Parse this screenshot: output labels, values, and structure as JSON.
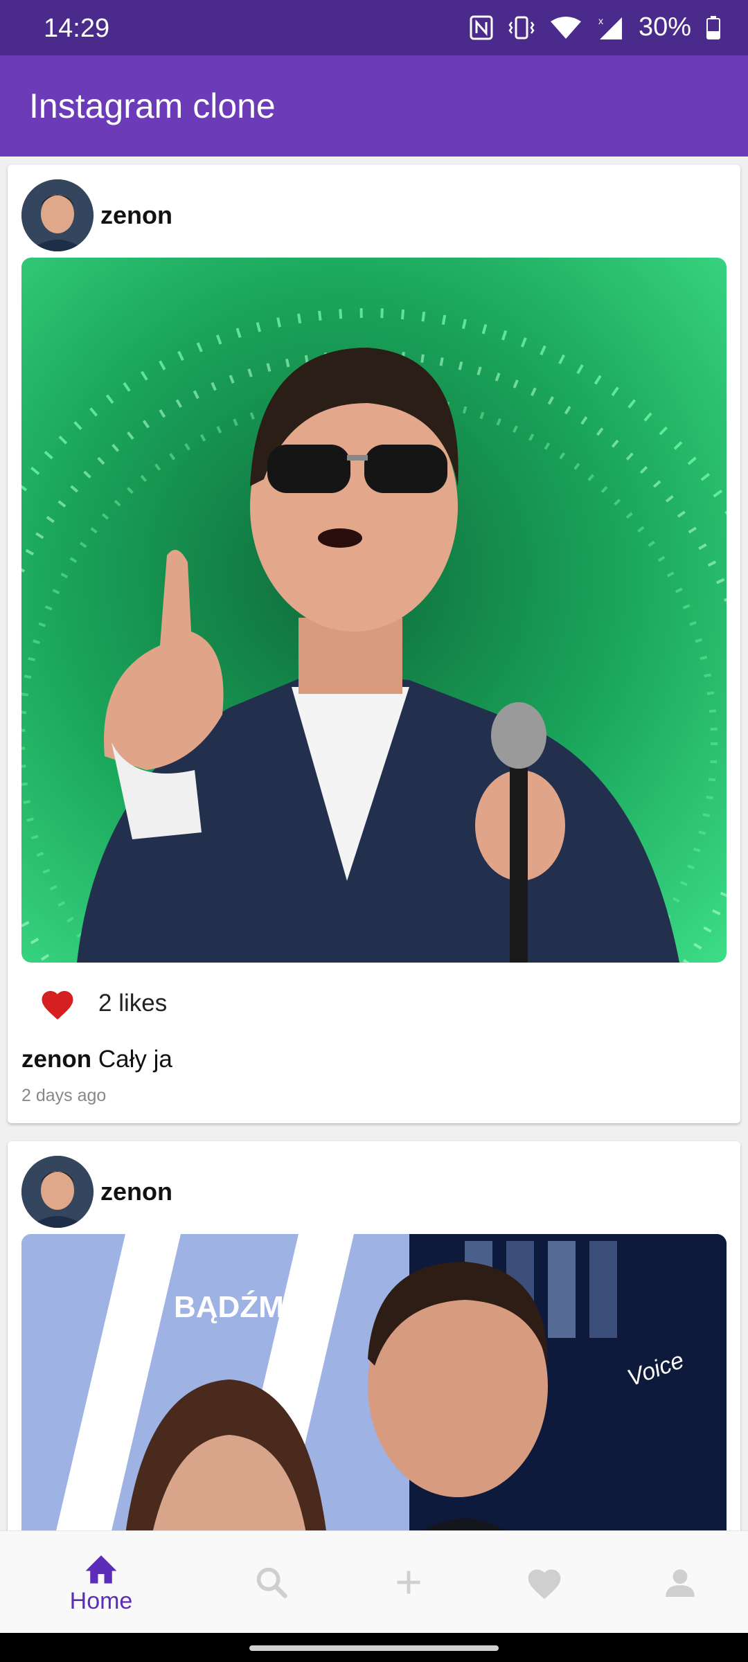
{
  "status_bar": {
    "time": "14:29",
    "battery": "30%"
  },
  "app_bar": {
    "title": "Instagram clone"
  },
  "posts": [
    {
      "username": "zenon",
      "likes_text": "2 likes",
      "caption_user": "zenon",
      "caption_text": "Cały ja",
      "time_ago": "2 days ago",
      "liked": true
    },
    {
      "username": "zenon",
      "image_text": "BĄDŹMY"
    }
  ],
  "bottom_nav": {
    "items": [
      {
        "icon": "home-icon",
        "label": "Home",
        "active": true
      },
      {
        "icon": "search-icon",
        "label": "",
        "active": false
      },
      {
        "icon": "add-icon",
        "label": "",
        "active": false
      },
      {
        "icon": "heart-icon",
        "label": "",
        "active": false
      },
      {
        "icon": "profile-icon",
        "label": "",
        "active": false
      }
    ]
  },
  "colors": {
    "status_bar": "#4a2a8a",
    "app_bar": "#6c3cb8",
    "accent": "#5b2db8",
    "like_heart": "#d42020",
    "inactive_icon": "#cfcfcf"
  }
}
